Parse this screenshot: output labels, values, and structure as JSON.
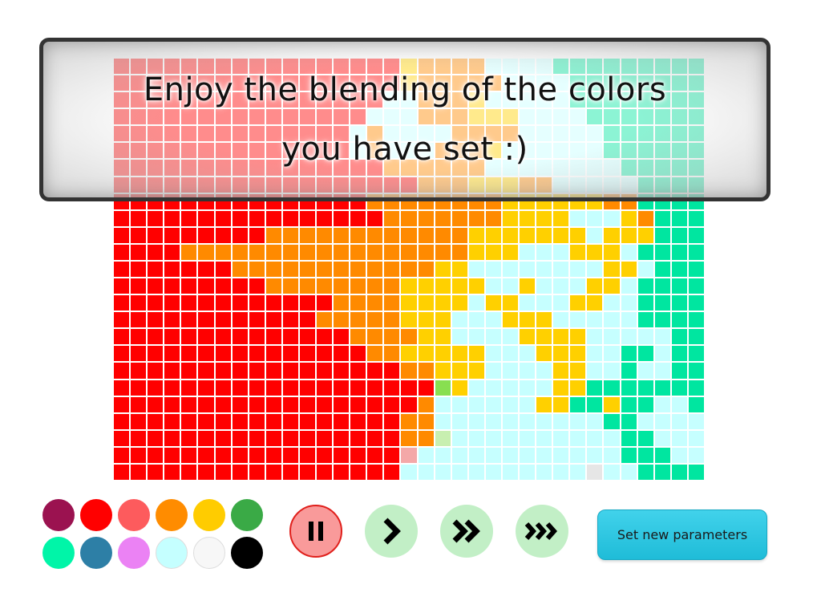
{
  "banner": {
    "line1": "Enjoy the blending of the colors",
    "line2": "you have set :)"
  },
  "grid": {
    "columns": 35,
    "rows": 25,
    "legend": {
      "R": "#ff0000",
      "r": "#fd3a3a",
      "O": "#ff8a00",
      "o": "#ff9f26",
      "Y": "#ffd000",
      "G": "#88df50",
      "g": "#c8efb0",
      "T": "#00e6a0",
      "t": "#40e9b4",
      "C": "#c6ffff",
      "c": "#d2efef",
      "P": "#f4a8a8",
      "W": "#e6e6e6",
      "K": "#d8c050",
      "k": "#b8c860"
    },
    "rows_data": [
      "RRRRRRRRRRRRRRRRRYOOOOCCCCTTTTTTTTTT",
      "RRRRRRRRRRRRRRRRRYOOOOOCCCCTTTTTTTTT",
      "RRRRRRRRRRRRRRRRCCOOOYCCCCCTTTTTTTTT",
      "RRRRRRRRRRRRRRRCCCOOOYYYCCCCTTTTTTTT",
      "RRRRRRRRRRRRRRCOCCCCOOOOCCCCCTTTTTTT",
      "RRRRRRRRRRRRRRCOCCCOOOYCCCCCCTTTTTTT",
      "RRRRRRRRRRRRRRRROOOOOOCCCCCCCCTTTTTT",
      "RRRRRRRRRRRRRRRRRROOOYYYOOCCCCCTTTTT",
      "RRRRRRRRRRRRRRROOOOOOOOYYYYYYOOTTTTT",
      "RRRRRRRRRRRRRRRROOOOOOOYYYYCCCYOTTTT",
      "RRRRRRRRROOOOOOOOOOOOYYYYYYYCYYYTTTT",
      "RRRROOOOOOOOOOOOOOOOOYYYCCCYYYCTTTTT",
      "RRRRRRROOOOOOOOOOOOYYCCCCCCCCYYCTTTT",
      "RRRRRRRRROOOOOOOOYYYYYCCYCCCYYCTTTTT",
      "RRRRRRRRRRRRROOOOYYYYCYYCCCYYCCTTTTT",
      "RRRRRRRRRRRROOOOOYYYCCCYYYCCCCCTTTTT",
      "RRRRRRRRRRRRRROOOOYYCCCCYYYYCCCCCTTT",
      "RRRRRRRRRRRRRRROOYYYYYCCCYYYCCTTCTTT",
      "RRRRRRRRRRRRRRRRROOYYYCCCCYYCCTCCTTT",
      "RRRRRRRRRRRRRRRRRRRGYCCCCCYYTTTTTTTT",
      "RRRRRRRRRRRRRRRRRROCCCCCCYYTTYTTCCTT",
      "RRRRRRRRRRRRRRRRROOCCCCCCCCCCTTCCCCC",
      "RRRRRRRRRRRRRRRRROOgCCCCCCCCCCTTCCCC",
      "RRRRRRRRRRRRRRRRRPCCCCCCCCCCCCTTTCCC",
      "RRRRRRRRRRRRRRRRRCCCCCCCCCCCWCCTTTTC"
    ]
  },
  "palette": [
    {
      "name": "maroon",
      "color": "#9b1250"
    },
    {
      "name": "red",
      "color": "#ff0000"
    },
    {
      "name": "salmon",
      "color": "#fd5b5d"
    },
    {
      "name": "orange",
      "color": "#ff8c00"
    },
    {
      "name": "yellow",
      "color": "#ffcc00"
    },
    {
      "name": "green",
      "color": "#3aaa46"
    },
    {
      "name": "mint",
      "color": "#00f5a8"
    },
    {
      "name": "steel-blue",
      "color": "#2d7fa6"
    },
    {
      "name": "violet",
      "color": "#eb82f4"
    },
    {
      "name": "light-cyan",
      "color": "#c5ffff"
    },
    {
      "name": "white",
      "color": "#f7f7f7"
    },
    {
      "name": "black",
      "color": "#000000"
    }
  ],
  "controls": {
    "pause_icon": "pause-icon",
    "play_icon": "play-icon",
    "fast_icon": "fast-forward-icon",
    "fastest_icon": "fastest-forward-icon",
    "set_params_label": "Set new parameters"
  }
}
